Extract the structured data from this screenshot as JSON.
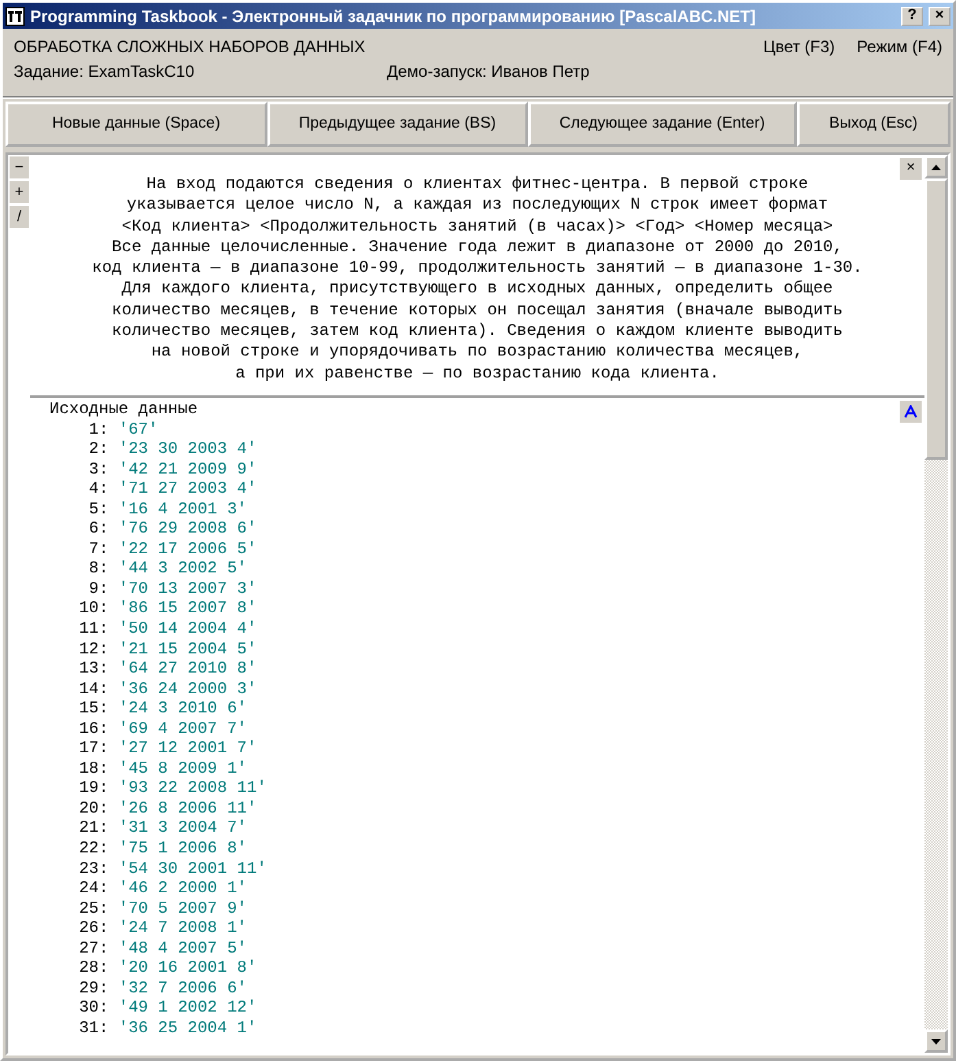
{
  "window": {
    "title": "Programming Taskbook - Электронный задачник по программированию [PascalABC.NET]",
    "buttons": [
      "?",
      "×"
    ]
  },
  "header": {
    "group": "ОБРАБОТКА СЛОЖНЫХ НАБОРОВ ДАННЫХ",
    "task": "Задание: ExamTaskC10",
    "demo": "Демо-запуск: Иванов Петр",
    "color_option": "Цвет (F3)",
    "mode_option": "Режим (F4)"
  },
  "toolbar": [
    "Новые данные (Space)",
    "Предыдущее задание (BS)",
    "Следующее задание (Enter)",
    "Выход (Esc)"
  ],
  "side_buttons": [
    "−",
    "+",
    "/"
  ],
  "description": {
    "close": "×",
    "lines": [
      "На вход подаются сведения о клиентах фитнес-центра. В первой строке",
      "указывается целое число N, а каждая из последующих N строк имеет формат",
      "<Код клиента> <Продолжительность занятий (в часах)> <Год> <Номер месяца>",
      "Все данные целочисленные. Значение года лежит в диапазоне от 2000 до 2010,",
      "код клиента — в диапазоне 10-99, продолжительность занятий — в диапазоне 1-30.",
      "Для каждого клиента, присутствующего в исходных данных, определить общее",
      "количество месяцев, в течение которых он посещал занятия (вначале выводить",
      "количество месяцев, затем код клиента). Сведения о каждом клиенте выводить",
      "на новой строке и упорядочивать по возрастанию количества месяцев,",
      "а при их равенстве — по возрастанию кода клиента."
    ]
  },
  "data_section": {
    "heading": "Исходные данные",
    "rows": [
      {
        "num": "1:",
        "value": "'67'"
      },
      {
        "num": "2:",
        "value": "'23 30 2003 4'"
      },
      {
        "num": "3:",
        "value": "'42 21 2009 9'"
      },
      {
        "num": "4:",
        "value": "'71 27 2003 4'"
      },
      {
        "num": "5:",
        "value": "'16 4 2001 3'"
      },
      {
        "num": "6:",
        "value": "'76 29 2008 6'"
      },
      {
        "num": "7:",
        "value": "'22 17 2006 5'"
      },
      {
        "num": "8:",
        "value": "'44 3 2002 5'"
      },
      {
        "num": "9:",
        "value": "'70 13 2007 3'"
      },
      {
        "num": "10:",
        "value": "'86 15 2007 8'"
      },
      {
        "num": "11:",
        "value": "'50 14 2004 4'"
      },
      {
        "num": "12:",
        "value": "'21 15 2004 5'"
      },
      {
        "num": "13:",
        "value": "'64 27 2010 8'"
      },
      {
        "num": "14:",
        "value": "'36 24 2000 3'"
      },
      {
        "num": "15:",
        "value": "'24 3 2010 6'"
      },
      {
        "num": "16:",
        "value": "'69 4 2007 7'"
      },
      {
        "num": "17:",
        "value": "'27 12 2001 7'"
      },
      {
        "num": "18:",
        "value": "'45 8 2009 1'"
      },
      {
        "num": "19:",
        "value": "'93 22 2008 11'"
      },
      {
        "num": "20:",
        "value": "'26 8 2006 11'"
      },
      {
        "num": "21:",
        "value": "'31 3 2004 7'"
      },
      {
        "num": "22:",
        "value": "'75 1 2006 8'"
      },
      {
        "num": "23:",
        "value": "'54 30 2001 11'"
      },
      {
        "num": "24:",
        "value": "'46 2 2000 1'"
      },
      {
        "num": "25:",
        "value": "'70 5 2007 9'"
      },
      {
        "num": "26:",
        "value": "'24 7 2008 1'"
      },
      {
        "num": "27:",
        "value": "'48 4 2007 5'"
      },
      {
        "num": "28:",
        "value": "'20 16 2001 8'"
      },
      {
        "num": "29:",
        "value": "'32 7 2006 6'"
      },
      {
        "num": "30:",
        "value": "'49 1 2002 12'"
      },
      {
        "num": "31:",
        "value": "'36 25 2004 1'"
      }
    ]
  }
}
